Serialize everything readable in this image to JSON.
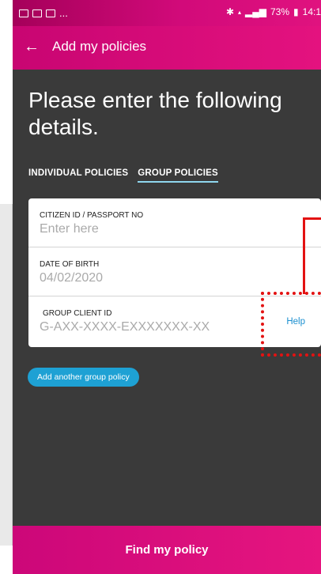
{
  "status_bar": {
    "left_text": "...",
    "right_text": "73%",
    "time": "14:1"
  },
  "header": {
    "title": "Add my policies"
  },
  "heading": "Please enter the following details.",
  "tabs": [
    {
      "label": "INDIVIDUAL POLICIES",
      "active": false
    },
    {
      "label": "GROUP POLICIES",
      "active": true
    }
  ],
  "form": {
    "citizen_id": {
      "label": "CITIZEN ID / PASSPORT NO",
      "placeholder": "Enter here"
    },
    "dob": {
      "label": "DATE OF BIRTH",
      "value": "04/02/2020"
    },
    "group_client_id": {
      "label": "GROUP CLIENT ID",
      "placeholder": "G-AXX-XXXX-EXXXXXXX-XX",
      "help": "Help"
    }
  },
  "add_button": "Add another group policy",
  "submit_button": "Find my policy",
  "colors": {
    "accent": "#e0127f",
    "link": "#1a8fd0",
    "pill": "#1ea1d4",
    "background": "#3a3a3a",
    "annotation": "#e31212"
  }
}
